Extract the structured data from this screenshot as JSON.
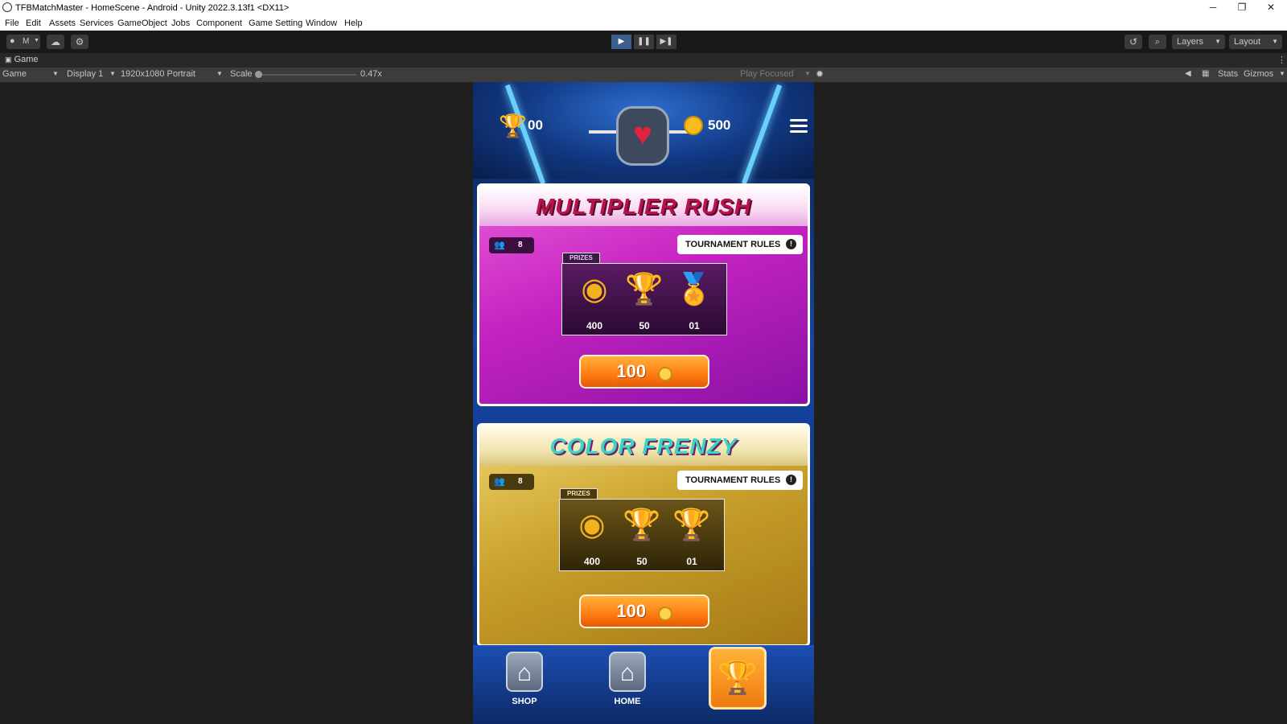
{
  "window": {
    "title": "TFBMatchMaster - HomeScene - Android - Unity 2022.3.13f1 <DX11>",
    "controls": {
      "minimize": "─",
      "restore": "❐",
      "close": "✕"
    }
  },
  "menu": [
    "File",
    "Edit",
    "Assets",
    "Services",
    "GameObject",
    "Jobs",
    "Component",
    "Game Setting",
    "Window",
    "Help"
  ],
  "toolbar": {
    "account_label": "M",
    "layers_label": "Layers",
    "layout_label": "Layout",
    "icons": [
      "account-icon",
      "cloud-icon",
      "settings-icon",
      "history-icon",
      "search-icon"
    ]
  },
  "game_tab": {
    "label": "Game"
  },
  "game_bar": {
    "mode": "Game",
    "display": "Display 1",
    "resolution": "1920x1080 Portrait",
    "scale_label": "Scale",
    "scale_value": "0.47x",
    "play_focus": "Play Focused",
    "stats": "Stats",
    "gizmos": "Gizmos"
  },
  "hud": {
    "trophies": "00",
    "coins": "500"
  },
  "tournaments": [
    {
      "title": "MULTIPLIER RUSH",
      "players": "8",
      "rules_label": "TOURNAMENT RULES",
      "prizes_label": "PRIZES",
      "prizes": [
        {
          "icon": "coins-icon",
          "value": "400"
        },
        {
          "icon": "trophy-icon",
          "value": "50"
        },
        {
          "icon": "medal-trophy-icon",
          "value": "01"
        }
      ],
      "entry_fee": "100"
    },
    {
      "title": "COLOR FRENZY",
      "players": "8",
      "rules_label": "TOURNAMENT RULES",
      "prizes_label": "PRIZES",
      "prizes": [
        {
          "icon": "coins-icon",
          "value": "400"
        },
        {
          "icon": "trophy-icon",
          "value": "50"
        },
        {
          "icon": "rainbow-trophy-icon",
          "value": "01"
        }
      ],
      "entry_fee": "100"
    }
  ],
  "nav": {
    "shop": "SHOP",
    "home": "HOME"
  },
  "colors": {
    "editor_bg": "#1f1f1f",
    "play_active": "#3b5e8c",
    "card1": "#c423c0",
    "card2": "#c9a12c",
    "entry_button": "#ff7c12"
  }
}
